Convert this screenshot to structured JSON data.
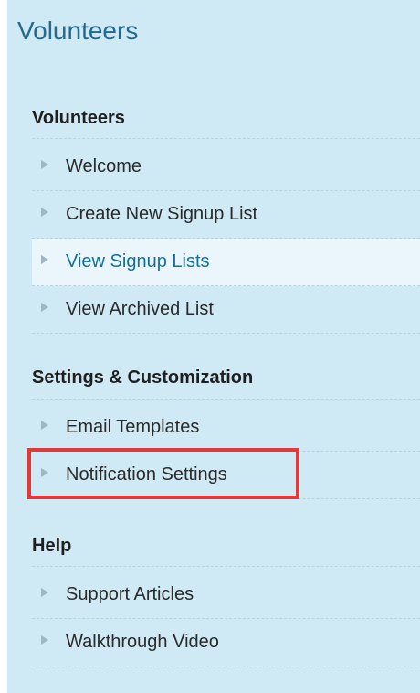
{
  "header": {
    "title": "Volunteers"
  },
  "sections": [
    {
      "heading": "Volunteers",
      "items": [
        {
          "label": "Welcome"
        },
        {
          "label": "Create New Signup List"
        },
        {
          "label": "View Signup Lists"
        },
        {
          "label": "View Archived List"
        }
      ]
    },
    {
      "heading": "Settings & Customization",
      "items": [
        {
          "label": "Email Templates"
        },
        {
          "label": "Notification Settings"
        }
      ]
    },
    {
      "heading": "Help",
      "items": [
        {
          "label": "Support Articles"
        },
        {
          "label": "Walkthrough Video"
        }
      ]
    }
  ],
  "active_item": "View Signup Lists",
  "highlighted_item": "Notification Settings",
  "colors": {
    "panel_bg": "#cfe9f5",
    "active_bg": "#eaf6fb",
    "active_text": "#0f6f9e",
    "title_text": "#246a8f",
    "highlight_border": "#e03a3a"
  },
  "icons": {
    "item_arrow": "arrow-right-icon"
  }
}
